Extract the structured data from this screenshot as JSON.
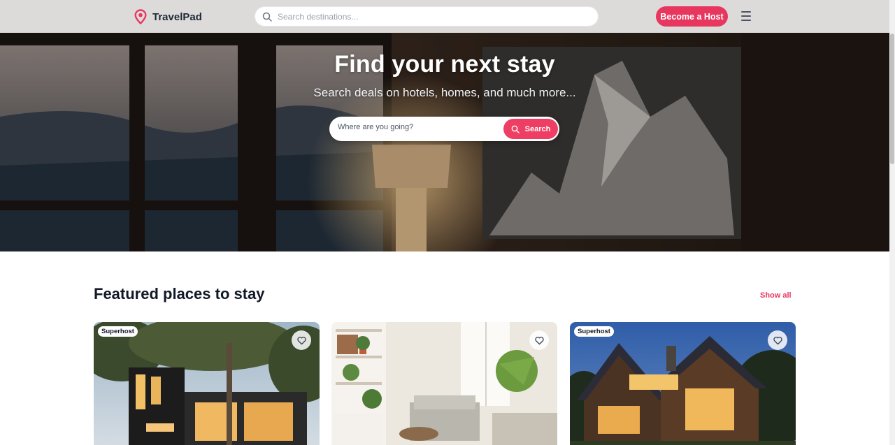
{
  "header": {
    "brand": "TravelPad",
    "search_placeholder": "Search destinations...",
    "host_label": "Become a Host"
  },
  "hero": {
    "title": "Find your next stay",
    "subtitle": "Search deals on hotels, homes, and much more...",
    "search_placeholder": "Where are you going?",
    "search_button": "Search"
  },
  "featured": {
    "title": "Featured places to stay",
    "show_all": "Show all",
    "cards": [
      {
        "badge": "Superhost"
      },
      {
        "badge": ""
      },
      {
        "badge": "Superhost"
      }
    ]
  },
  "colors": {
    "accent": "#e8375f",
    "header_bg": "#dcdad8",
    "text_dark": "#111827"
  },
  "icons": [
    "map-pin-icon",
    "search-icon",
    "menu-icon",
    "heart-icon"
  ]
}
